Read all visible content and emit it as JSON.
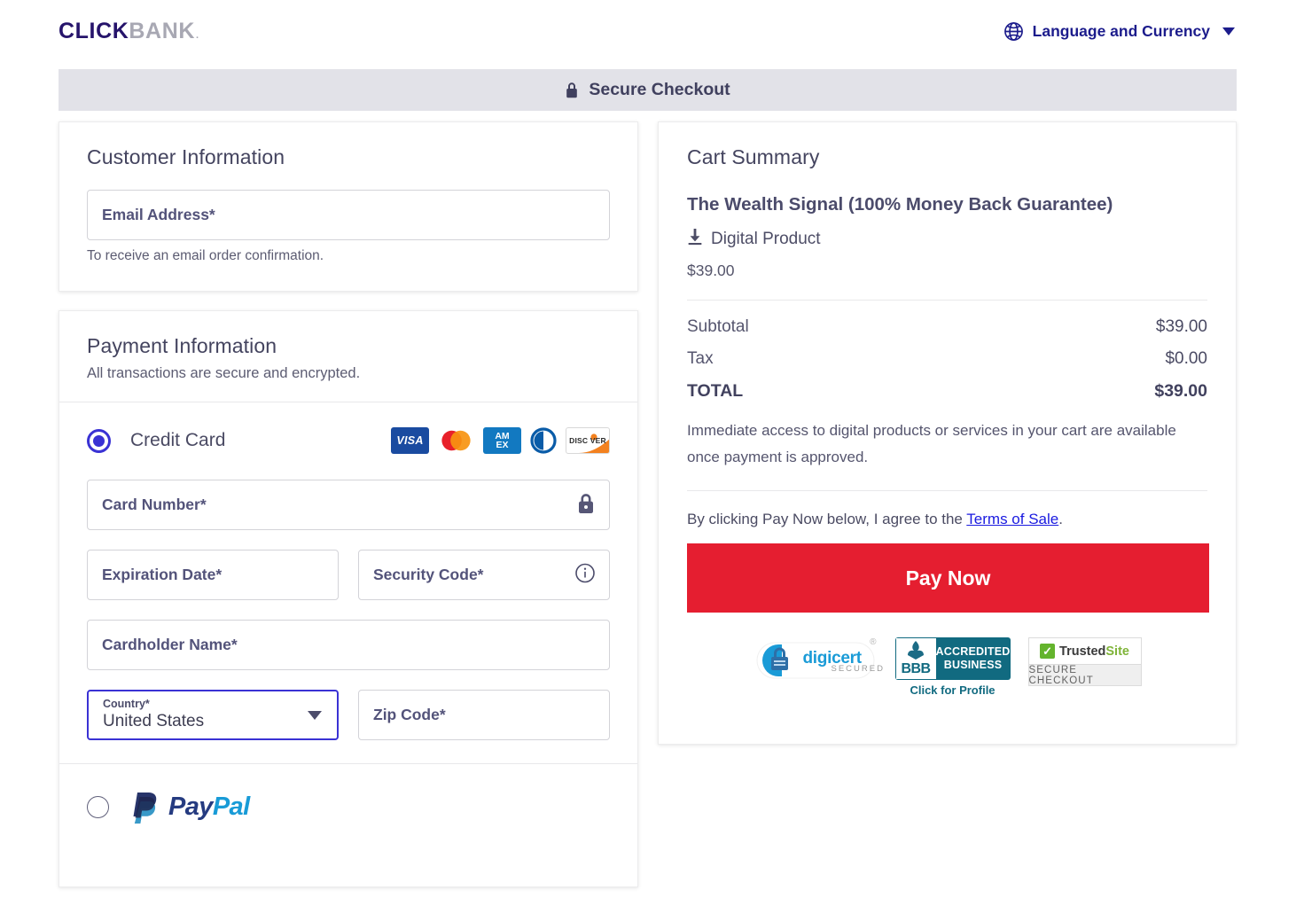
{
  "header": {
    "logo_primary": "CLICK",
    "logo_secondary": "BANK",
    "logo_tm": ".",
    "language_label": "Language and Currency",
    "globe_icon": "globe-icon",
    "caret_icon": "chevron-down-icon"
  },
  "secure_bar": {
    "label": "Secure Checkout",
    "lock_icon": "lock-icon"
  },
  "customer": {
    "title": "Customer Information",
    "email": {
      "placeholder": "Email Address*",
      "value": "",
      "helper": "To receive an email order confirmation."
    }
  },
  "payment": {
    "title": "Payment Information",
    "subtitle": "All transactions are secure and encrypted.",
    "methods": [
      {
        "id": "credit-card",
        "label": "Credit Card",
        "selected": true
      },
      {
        "id": "paypal",
        "label": "PayPal",
        "selected": false
      }
    ],
    "card_brands": [
      "VISA",
      "Mastercard",
      "AMEX",
      "Diners Club",
      "DISCOVER"
    ],
    "brand_text": {
      "visa": "VISA",
      "amex_line1": "AM",
      "amex_line2": "EX",
      "discover": "DISC VER"
    },
    "paypal_logo": {
      "part1": "Pay",
      "part2": "Pal"
    },
    "fields": {
      "card_number": {
        "placeholder": "Card Number*",
        "value": "",
        "icon": "lock-icon"
      },
      "expiration": {
        "placeholder": "Expiration Date*",
        "value": ""
      },
      "security_code": {
        "placeholder": "Security Code*",
        "value": "",
        "icon": "info-icon"
      },
      "cardholder": {
        "placeholder": "Cardholder Name*",
        "value": ""
      },
      "country": {
        "label": "Country*",
        "value": "United States",
        "icon": "chevron-down-icon"
      },
      "zip": {
        "placeholder": "Zip Code*",
        "value": ""
      }
    }
  },
  "summary": {
    "title": "Cart Summary",
    "product_name": "The Wealth Signal (100% Money Back Guarantee)",
    "product_type": "Digital Product",
    "product_type_icon": "download-icon",
    "product_price": "$39.00",
    "lines": [
      {
        "label": "Subtotal",
        "amount": "$39.00",
        "bold": false
      },
      {
        "label": "Tax",
        "amount": "$0.00",
        "bold": false
      },
      {
        "label": "TOTAL",
        "amount": "$39.00",
        "bold": true
      }
    ],
    "note": "Immediate access to digital products or services in your cart are available once payment is approved.",
    "terms_prefix": "By clicking Pay Now below, I agree to the ",
    "terms_link": "Terms of Sale",
    "terms_suffix": ".",
    "pay_button": "Pay Now"
  },
  "badges": {
    "digicert": {
      "name": "digicert",
      "sub": "SECURED",
      "mark": "®"
    },
    "bbb": {
      "word": "BBB",
      "line1": "ACCREDITED",
      "line2": "BUSINESS",
      "cta": "Click for Profile"
    },
    "trustedsite": {
      "name_a": "Trusted",
      "name_b": "Site",
      "sub": "SECURE CHECKOUT",
      "check": "✓"
    }
  },
  "colors": {
    "accent_indigo": "#3a32d4",
    "brand_navy": "#26146b",
    "pay_red": "#e51e30",
    "bar_gray": "#e2e2e8",
    "link_blue": "#1a1ae0"
  }
}
